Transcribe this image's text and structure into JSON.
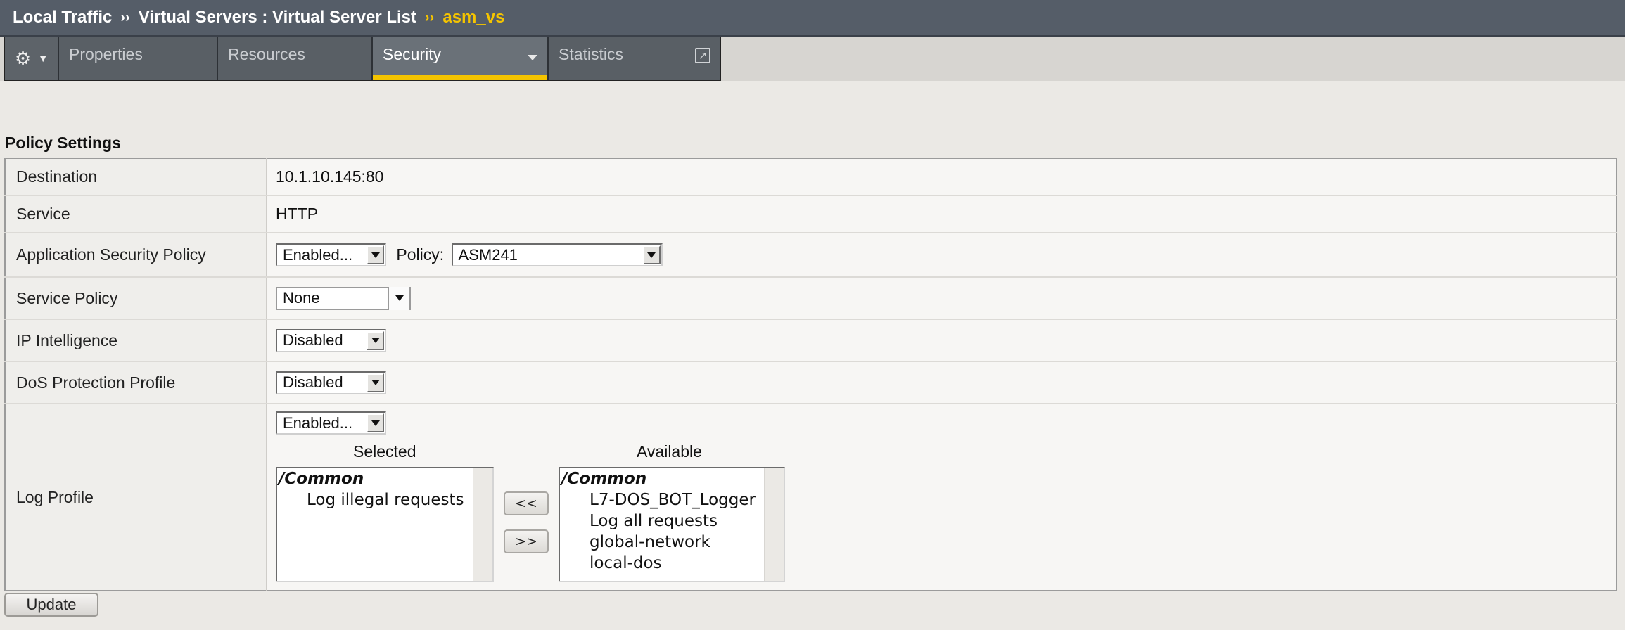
{
  "breadcrumb": {
    "items": [
      "Local Traffic",
      "Virtual Servers : Virtual Server List",
      "asm_vs"
    ],
    "separator": "››"
  },
  "tabs": {
    "gear_icon": "gear-icon",
    "items": [
      "Properties",
      "Resources",
      "Security",
      "Statistics"
    ],
    "active": "Security"
  },
  "section": {
    "title": "Policy Settings"
  },
  "settings": {
    "destination": {
      "label": "Destination",
      "value": "10.1.10.145:80"
    },
    "service": {
      "label": "Service",
      "value": "HTTP"
    },
    "app_security": {
      "label": "Application Security Policy",
      "state": "Enabled...",
      "policy_label": "Policy:",
      "policy": "ASM241"
    },
    "service_policy": {
      "label": "Service Policy",
      "value": "None"
    },
    "ip_intelligence": {
      "label": "IP Intelligence",
      "value": "Disabled"
    },
    "dos_profile": {
      "label": "DoS Protection Profile",
      "value": "Disabled"
    },
    "log_profile": {
      "label": "Log Profile",
      "state": "Enabled...",
      "selected_title": "Selected",
      "available_title": "Available",
      "selected_group": "/Common",
      "selected": [
        "Log illegal requests"
      ],
      "available_group": "/Common",
      "available": [
        "L7-DOS_BOT_Logger",
        "Log all requests",
        "global-network",
        "local-dos"
      ],
      "move_left": "<<",
      "move_right": ">>"
    }
  },
  "actions": {
    "update": "Update"
  },
  "colors": {
    "accent": "#f5c400",
    "titlebar": "#555d68",
    "tab": "#595f65"
  }
}
